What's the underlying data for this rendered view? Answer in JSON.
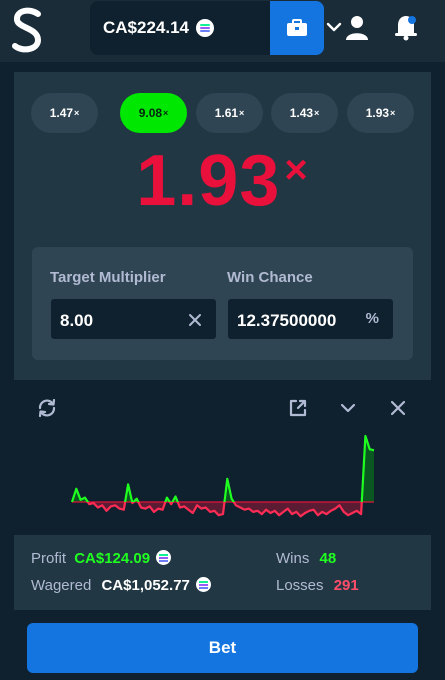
{
  "header": {
    "balance": "CA$224.14",
    "currency_icon": "solana-coin-icon",
    "wallet_icon": "wallet-icon",
    "user_icon": "user-icon",
    "bell_icon": "bell-icon"
  },
  "history": [
    {
      "value": "1.47",
      "suffix": "×",
      "win": false
    },
    {
      "value": "9.08",
      "suffix": "×",
      "win": true
    },
    {
      "value": "1.61",
      "suffix": "×",
      "win": false
    },
    {
      "value": "1.43",
      "suffix": "×",
      "win": false
    },
    {
      "value": "1.93",
      "suffix": "×",
      "win": false
    }
  ],
  "result": {
    "value": "1.93",
    "suffix": "×",
    "color": "#e9113c"
  },
  "controls": {
    "target_label": "Target Multiplier",
    "target_value": "8.00",
    "chance_label": "Win Chance",
    "chance_value": "12.37500000",
    "chance_suffix": "%"
  },
  "stats": {
    "profit_label": "Profit",
    "profit_value": "CA$124.09",
    "wagered_label": "Wagered",
    "wagered_value": "CA$1,052.77",
    "wins_label": "Wins",
    "wins_value": "48",
    "losses_label": "Losses",
    "losses_value": "291"
  },
  "bet_button": "Bet",
  "colors": {
    "accent": "#1475e1",
    "win": "#00e701",
    "loss": "#e9113c",
    "background": "#0f212e"
  },
  "chart_data": {
    "type": "area",
    "series": [
      {
        "values": [
          0,
          12,
          2,
          4,
          -2,
          -1,
          -5,
          -3,
          -8,
          -4,
          -3,
          -6,
          -7,
          16,
          -1,
          3,
          -5,
          -6,
          -4,
          -9,
          -6,
          -7,
          4,
          -2,
          5,
          -5,
          -4,
          -7,
          -10,
          -3,
          -6,
          -5,
          -9,
          -8,
          -12,
          -11,
          21,
          3,
          -3,
          -5,
          -7,
          -6,
          -9,
          -8,
          -11,
          -7,
          -10,
          -8,
          -12,
          -9,
          -6,
          -11,
          -9,
          -13,
          -10,
          -8,
          -7,
          -12,
          -9,
          -11,
          -8,
          -6,
          -3,
          -9,
          -12,
          -10,
          -8,
          -11,
          60,
          48,
          47
        ]
      }
    ]
  }
}
